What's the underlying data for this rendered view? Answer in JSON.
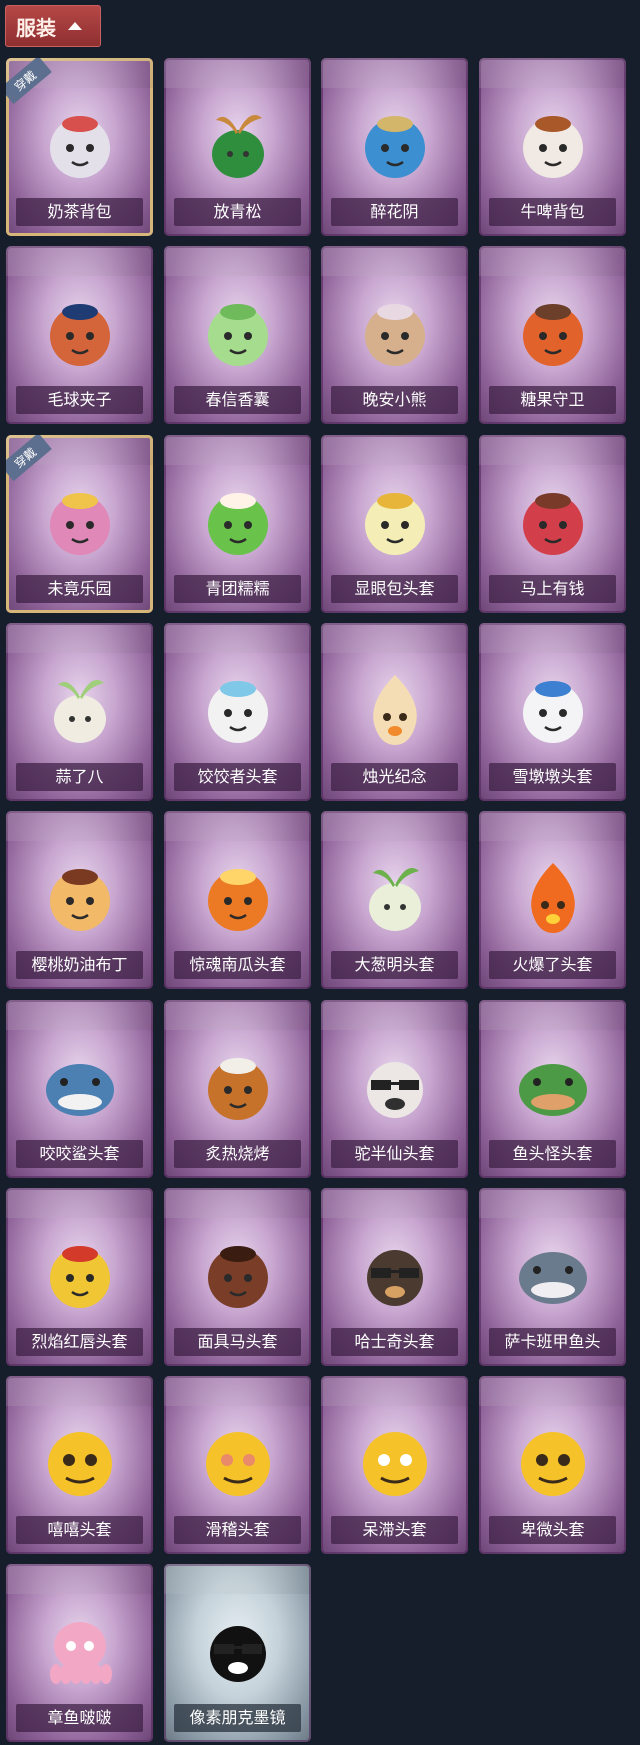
{
  "header": {
    "label": "服装",
    "icon": "chevron-up-icon"
  },
  "badge_text": "穿戴",
  "items": [
    {
      "label": "奶茶背包",
      "equipped": true,
      "icon": "milk-tea-backpack-icon",
      "color": "#e4e0ea",
      "accent": "#d8504e"
    },
    {
      "label": "放青松",
      "equipped": false,
      "icon": "potted-pine-icon",
      "color": "#2f8e3d",
      "accent": "#c9893d"
    },
    {
      "label": "醉花阴",
      "equipped": false,
      "icon": "dreamcatcher-icon",
      "color": "#3c8fd0",
      "accent": "#d3b66a"
    },
    {
      "label": "牛啤背包",
      "equipped": false,
      "icon": "cow-beer-barrel-icon",
      "color": "#f1e9e3",
      "accent": "#a9582a"
    },
    {
      "label": "毛球夹子",
      "equipped": false,
      "icon": "raccoon-soldier-clip-icon",
      "color": "#d4643a",
      "accent": "#1f3b73"
    },
    {
      "label": "春信香囊",
      "equipped": false,
      "icon": "sachet-icon",
      "color": "#a6dc8e",
      "accent": "#6fba5a"
    },
    {
      "label": "晚安小熊",
      "equipped": false,
      "icon": "bear-charm-icon",
      "color": "#d6b08c",
      "accent": "#e8d8e2"
    },
    {
      "label": "糖果守卫",
      "equipped": false,
      "icon": "pumpkin-scarecrow-icon",
      "color": "#e2622c",
      "accent": "#6b3f2a"
    },
    {
      "label": "未竟乐园",
      "equipped": true,
      "icon": "pink-hair-doll-icon",
      "color": "#e088b8",
      "accent": "#f0c44a"
    },
    {
      "label": "青团糯糯",
      "equipped": false,
      "icon": "green-rice-ball-icon",
      "color": "#69c24a",
      "accent": "#fff3e8"
    },
    {
      "label": "显眼包头套",
      "equipped": false,
      "icon": "light-bulb-head-icon",
      "color": "#f4eeb6",
      "accent": "#e7b53a"
    },
    {
      "label": "马上有钱",
      "equipped": false,
      "icon": "red-horse-head-icon",
      "color": "#d23e4a",
      "accent": "#7a3a2a"
    },
    {
      "label": "蒜了八",
      "equipped": false,
      "icon": "garlic-head-icon",
      "color": "#f1ece2",
      "accent": "#9fcf7a"
    },
    {
      "label": "饺饺者头套",
      "equipped": false,
      "icon": "dumpling-head-icon",
      "color": "#f3f2f2",
      "accent": "#7fc8e8"
    },
    {
      "label": "烛光纪念",
      "equipped": false,
      "icon": "candle-head-icon",
      "color": "#f4dcb4",
      "accent": "#f08a2a"
    },
    {
      "label": "雪墩墩头套",
      "equipped": false,
      "icon": "snowman-head-icon",
      "color": "#f4f4f6",
      "accent": "#3d7fd0"
    },
    {
      "label": "樱桃奶油布丁",
      "equipped": false,
      "icon": "pudding-head-icon",
      "color": "#f2b968",
      "accent": "#7a3a22"
    },
    {
      "label": "惊魂南瓜头套",
      "equipped": false,
      "icon": "jack-o-lantern-icon",
      "color": "#ec7a25",
      "accent": "#ffd56a"
    },
    {
      "label": "大葱明头套",
      "equipped": false,
      "icon": "scallion-head-icon",
      "color": "#e9efd9",
      "accent": "#6cb14c"
    },
    {
      "label": "火爆了头套",
      "equipped": false,
      "icon": "flame-head-icon",
      "color": "#f06a1f",
      "accent": "#ffd23a"
    },
    {
      "label": "咬咬鲨头套",
      "equipped": false,
      "icon": "shark-head-icon",
      "color": "#4c7fb2",
      "accent": "#f2f2f2"
    },
    {
      "label": "炙热烧烤",
      "equipped": false,
      "icon": "grilled-meat-icon",
      "color": "#c6722a",
      "accent": "#f2efe8"
    },
    {
      "label": "驼半仙头套",
      "equipped": false,
      "icon": "alpaca-sunglasses-icon",
      "color": "#ece6e4",
      "accent": "#303030"
    },
    {
      "label": "鱼头怪头套",
      "equipped": false,
      "icon": "fish-head-mask-icon",
      "color": "#4d9a46",
      "accent": "#e0a06a"
    },
    {
      "label": "烈焰红唇头套",
      "equipped": false,
      "icon": "yellow-mascot-head-icon",
      "color": "#f0c634",
      "accent": "#d43a2a"
    },
    {
      "label": "面具马头套",
      "equipped": false,
      "icon": "horse-mask-icon",
      "color": "#7a3e28",
      "accent": "#3a1c10"
    },
    {
      "label": "哈士奇头套",
      "equipped": false,
      "icon": "husky-sunglasses-icon",
      "color": "#4a3a30",
      "accent": "#d7a164"
    },
    {
      "label": "萨卡班甲鱼头",
      "equipped": false,
      "icon": "sacabambaspis-head-icon",
      "color": "#6a7b8e",
      "accent": "#f0eef0"
    },
    {
      "label": "嘻嘻头套",
      "equipped": false,
      "icon": "grinning-emoji-icon",
      "color": "#f6c22a",
      "accent": "#3a2a1a"
    },
    {
      "label": "滑稽头套",
      "equipped": false,
      "icon": "smirk-emoji-icon",
      "color": "#f6c22a",
      "accent": "#e98a6a"
    },
    {
      "label": "呆滞头套",
      "equipped": false,
      "icon": "dazed-emoji-icon",
      "color": "#f6c22a",
      "accent": "#ffffff"
    },
    {
      "label": "卑微头套",
      "equipped": false,
      "icon": "humble-emoji-icon",
      "color": "#f6c22a",
      "accent": "#3a2a1a"
    },
    {
      "label": "章鱼啵啵",
      "equipped": false,
      "icon": "pink-octopus-icon",
      "color": "#f2a7c4",
      "accent": "#ffffff"
    },
    {
      "label": "像素朋克墨镜",
      "equipped": false,
      "icon": "pixel-sunglasses-icon",
      "color": "#111111",
      "accent": "#ffffff",
      "grey": true
    }
  ]
}
